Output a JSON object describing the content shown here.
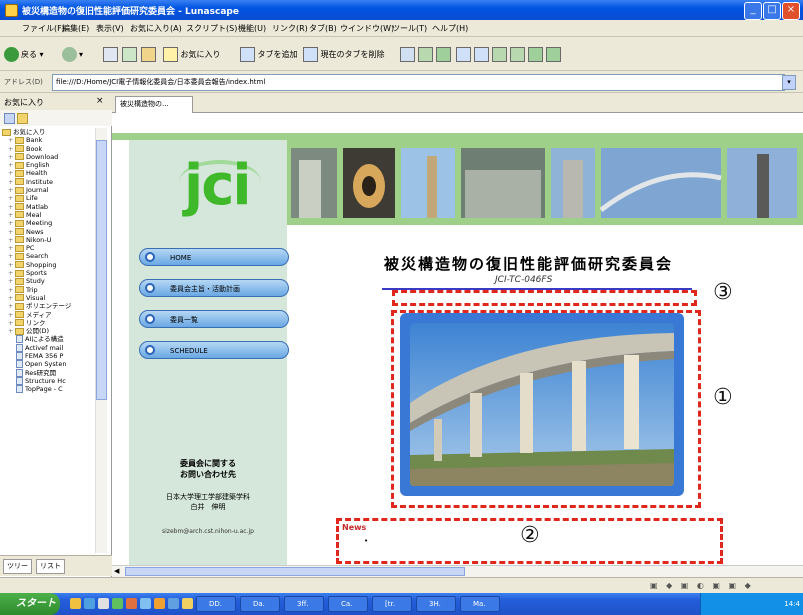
{
  "window": {
    "title": "被災構造物の復旧性能評価研究委員会 - Lunascape",
    "controls": [
      "_",
      "□",
      "×"
    ]
  },
  "menu": [
    "ファイル(F)",
    "編集(E)",
    "表示(V)",
    "お気に入り(A)",
    "スクリプト(S)",
    "機能(U)",
    "リンク(R)",
    "タブ(B)",
    "ウインドウ(W)",
    "ツール(T)",
    "ヘルプ(H)"
  ],
  "toolbar": {
    "back": "戻る",
    "favorites": "お気に入り",
    "add_tab": "タブを追加",
    "close_others": "現在のタブを削除"
  },
  "address": {
    "label": "アドレス(D)",
    "url": "file:///D:/Home/JCI電子情報化委員会/日本委員会報告/index.html"
  },
  "favorites": {
    "title": "お気に入り",
    "close": "×",
    "items": [
      {
        "label": "お気に入り",
        "type": "root"
      },
      {
        "label": "Bank",
        "type": "folder"
      },
      {
        "label": "Book",
        "type": "folder"
      },
      {
        "label": "Download",
        "type": "folder"
      },
      {
        "label": "English",
        "type": "folder"
      },
      {
        "label": "Health",
        "type": "folder"
      },
      {
        "label": "Institute",
        "type": "folder"
      },
      {
        "label": "Journal",
        "type": "folder"
      },
      {
        "label": "Life",
        "type": "folder"
      },
      {
        "label": "Matlab",
        "type": "folder"
      },
      {
        "label": "Meal",
        "type": "folder"
      },
      {
        "label": "Meeting",
        "type": "folder"
      },
      {
        "label": "News",
        "type": "folder"
      },
      {
        "label": "Nikon-U",
        "type": "folder"
      },
      {
        "label": "PC",
        "type": "folder"
      },
      {
        "label": "Search",
        "type": "folder"
      },
      {
        "label": "Shopping",
        "type": "folder"
      },
      {
        "label": "Sports",
        "type": "folder"
      },
      {
        "label": "Study",
        "type": "folder"
      },
      {
        "label": "Trip",
        "type": "folder"
      },
      {
        "label": "Visual",
        "type": "folder"
      },
      {
        "label": "ポリエンテージ",
        "type": "folder"
      },
      {
        "label": "メディア",
        "type": "folder"
      },
      {
        "label": "リンク",
        "type": "folder"
      },
      {
        "label": "公開(D)",
        "type": "folder"
      },
      {
        "label": "AIによる構造",
        "type": "doc"
      },
      {
        "label": "Activef mail",
        "type": "doc"
      },
      {
        "label": "FEMA 356 P",
        "type": "doc"
      },
      {
        "label": "Open Systen",
        "type": "doc"
      },
      {
        "label": "Res研究開",
        "type": "doc"
      },
      {
        "label": "Structure Hc",
        "type": "doc"
      },
      {
        "label": "TopPage - C",
        "type": "doc"
      }
    ],
    "tabs": [
      "ツリー",
      "リスト"
    ]
  },
  "tab": {
    "label": "被災構造物の..."
  },
  "site": {
    "logo": "jci",
    "nav": [
      "HOME",
      "委員会主旨・活動計画",
      "委員一覧",
      "SCHEDULE"
    ],
    "contact_title_1": "委員会に関する",
    "contact_title_2": "お問い合わせ先",
    "contact_org_1": "日本大学理工学部建築学科",
    "contact_org_2": "白井　伸明",
    "contact_mail": "sizebm@arch.cst.nihon-u.ac.jp",
    "title": "被災構造物の復旧性能評価研究委員会",
    "code": "JCI-TC-046FS",
    "news": "News",
    "news_bullet": "•"
  },
  "annotations": [
    "③",
    "①",
    "②"
  ],
  "taskbar": {
    "start": "スタート",
    "tasks": [
      "DD.",
      "Da.",
      "3ff.",
      "Ca.",
      "[tr.",
      "3H.",
      "Ma."
    ],
    "clock": "14:4"
  },
  "colors": {
    "logo_green": "#3fb82a",
    "nav_blue": "#6aa8e4",
    "annotation_red": "#e1261c",
    "rule_blue": "#3a3ac4"
  }
}
